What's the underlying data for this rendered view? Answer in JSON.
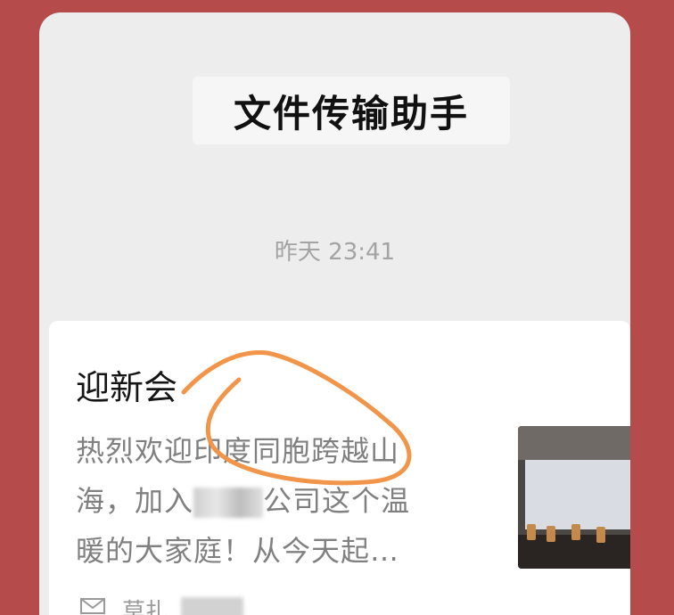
{
  "header": {
    "title": "文件传输助手"
  },
  "chat": {
    "timestamp": "昨天 23:41"
  },
  "message_card": {
    "title": "迎新会",
    "description": {
      "line1": "热烈欢迎印度同胞跨越山",
      "line2_before": "海，加入",
      "line2_after": "公司这个温",
      "line3": "暖的大家庭！从今天起…"
    },
    "thumbnail_icon": "meeting-room-photo",
    "footer_label": "莫扎"
  },
  "colors": {
    "background": "#b64b4b",
    "annotation": "#f0954a"
  }
}
